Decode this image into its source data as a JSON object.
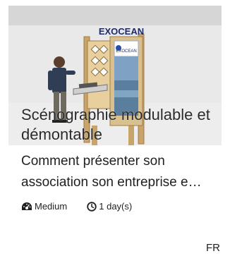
{
  "card": {
    "image": {
      "brand_text": "EXOCEAN",
      "panel_text": "EXOCEAN"
    },
    "title": "Scénographie modulable et démontable",
    "description": "Comment présenter son association son entreprise e…",
    "meta": {
      "difficulty_icon": "dashboard-icon",
      "difficulty": "Medium",
      "duration_icon": "clock-icon",
      "duration": "1 day(s)"
    },
    "language": "FR"
  }
}
